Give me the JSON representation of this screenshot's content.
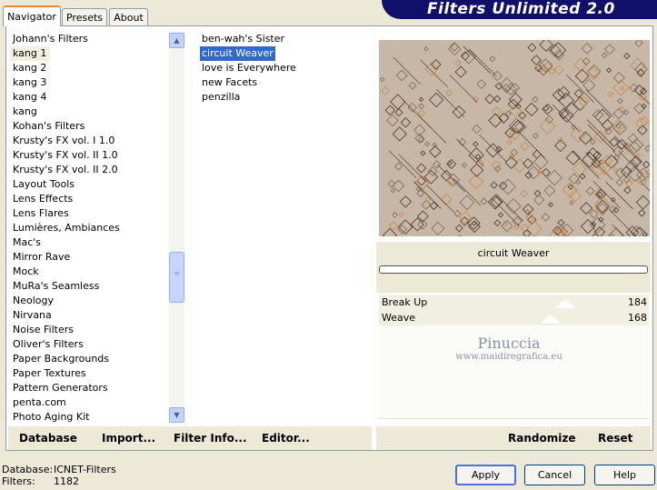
{
  "banner": {
    "title": "Filters Unlimited 2.0"
  },
  "tabs": [
    {
      "label": "Navigator",
      "active": true
    },
    {
      "label": "Presets",
      "active": false
    },
    {
      "label": "About",
      "active": false
    }
  ],
  "categories": [
    "Johann's Filters",
    "kang 1",
    "kang 2",
    "kang 3",
    "kang 4",
    "kang",
    "Kohan's Filters",
    "Krusty's FX vol. I 1.0",
    "Krusty's FX vol. II 1.0",
    "Krusty's FX vol. II 2.0",
    "Layout Tools",
    "Lens Effects",
    "Lens Flares",
    "Lumières, Ambiances",
    "Mac's",
    "Mirror Rave",
    "Mock",
    "MuRa's Seamless",
    "Neology",
    "Nirvana",
    "Noise Filters",
    "Oliver's Filters",
    "Paper Backgrounds",
    "Paper Textures",
    "Pattern Generators",
    "penta.com",
    "Photo Aging Kit"
  ],
  "selected_category": "kang 1",
  "filters": [
    "ben-wah's Sister",
    "circuit Weaver",
    "love is Everywhere",
    "new Facets",
    "penzilla"
  ],
  "selected_filter": "circuit Weaver",
  "preview": {
    "filter_name": "circuit Weaver",
    "progress": 0
  },
  "controls": [
    {
      "label": "Break Up",
      "value": "184",
      "level": 0.72
    },
    {
      "label": "Weave",
      "value": "168",
      "level": 0.66
    }
  ],
  "bottom_links": {
    "database": "Database",
    "import": "Import...",
    "filter_info": "Filter Info...",
    "editor": "Editor...",
    "randomize": "Randomize",
    "reset": "Reset"
  },
  "status": {
    "database_label": "Database:",
    "database_value": "ICNET-Filters",
    "filters_label": "Filters:",
    "filters_value": "1182"
  },
  "buttons": {
    "apply": "Apply",
    "cancel": "Cancel",
    "help": "Help"
  },
  "watermark": {
    "name": "Pinuccia",
    "url": "www.maidiregrafica.eu"
  },
  "colors": {
    "banner": "#10106b",
    "selection": "#316ac5",
    "tab_accent": "#e68b2c",
    "preview_bg": "#c7b7a7"
  }
}
